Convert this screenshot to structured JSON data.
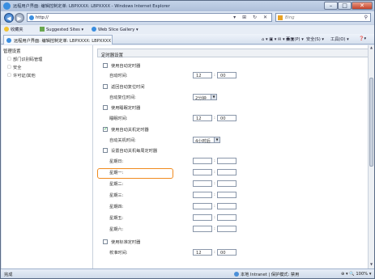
{
  "window": {
    "title": "远程用户界面: 编辑控制定单: LBPXXXX: LBPXXXX - Windows Internet Explorer",
    "min": "–",
    "max": "□",
    "close": "✕"
  },
  "address": {
    "url": "http://",
    "search_placeholder": "Bing"
  },
  "favorites": {
    "label": "收藏夹",
    "suggested": "Suggested Sites ▾",
    "gallery": "Web Slice Gallery ▾"
  },
  "tab": {
    "label": "远程用户界面: 编辑控制定单: LBPXXXX: LBPXXXX"
  },
  "commands": {
    "page": "页面(P) ▾",
    "safety": "安全(S) ▾",
    "tools": "工具(O) ▾",
    "help": "❓▾"
  },
  "sidebar": {
    "head": "管理设置",
    "items": [
      {
        "label": "部门识别码管理"
      },
      {
        "label": "安全"
      },
      {
        "label": "许可证/其他"
      }
    ]
  },
  "panel": {
    "title": "定时器设置",
    "auto_clear_cb": "使用自动定时器",
    "auto_clear_time_label": "自动时间:",
    "auto_clear_hour": "12",
    "auto_clear_min": "00",
    "auto_reset_cb": "返回自动复位时间",
    "auto_reset_label": "自动复位时间:",
    "auto_reset_value": "2分钟",
    "sleep_cb": "使用睡眠定时器",
    "sleep_label": "睡眠时间:",
    "sleep_hour": "12",
    "sleep_min": "00",
    "auto_off_cb": "使用自动关机定时器",
    "auto_off_label": "自动关机时间:",
    "auto_off_value": "4小时后",
    "weekly_cb": "设置自动关机每周定时器",
    "days": [
      "星期日:",
      "星期一:",
      "星期二:",
      "星期三:",
      "星期四:",
      "星期五:",
      "星期六:"
    ],
    "std_cb": "使用标准定时器",
    "std_label": "校准时间:",
    "std_hour": "12",
    "std_min": "00"
  },
  "status": {
    "done": "完成",
    "zone": "本地 Intranet | 保护模式: 禁用",
    "zoom": "⊕ ▾  🔍 100% ▾"
  }
}
